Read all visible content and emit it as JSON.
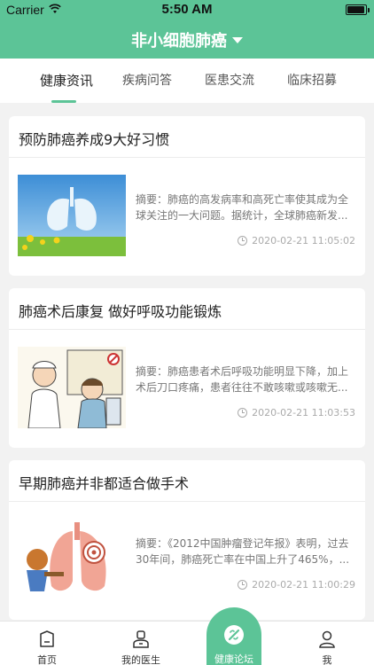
{
  "status_bar": {
    "carrier": "Carrier",
    "time": "5:50 AM",
    "battery_level": 0.95
  },
  "header": {
    "title": "非小细胞肺癌"
  },
  "tabs": [
    {
      "label": "健康资讯",
      "active": true
    },
    {
      "label": "疾病问答",
      "active": false
    },
    {
      "label": "医患交流",
      "active": false
    },
    {
      "label": "临床招募",
      "active": false
    }
  ],
  "articles": [
    {
      "title": "预防肺癌养成9大好习惯",
      "summary": "摘要：肺癌的高发病率和高死亡率使其成为全球关注的一大问题。据统计，全球肺癌新发...",
      "time": "2020-02-21 11:05:02"
    },
    {
      "title": "肺癌术后康复 做好呼吸功能锻炼",
      "summary": "摘要：肺癌患者术后呼吸功能明显下降，加上术后刀口疼痛，患者往往不敢咳嗽或咳嗽无...",
      "time": "2020-02-21 11:03:53"
    },
    {
      "title": "早期肺癌并非都适合做手术",
      "summary": "摘要：《2012中国肿瘤登记年报》表明，过去30年间，肺癌死亡率在中国上升了465%，...",
      "time": "2020-02-21 11:00:29"
    }
  ],
  "tabbar": [
    {
      "label": "首页",
      "icon": "home-icon"
    },
    {
      "label": "我的医生",
      "icon": "doctor-icon"
    },
    {
      "label": "健康论坛",
      "icon": "forum-icon",
      "active": true
    },
    {
      "label": "我",
      "icon": "person-icon"
    }
  ],
  "colors": {
    "accent": "#5cc497",
    "background": "#f2f2f2"
  }
}
